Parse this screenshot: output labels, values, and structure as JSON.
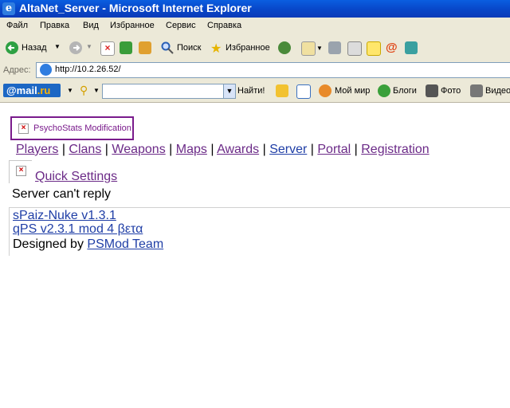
{
  "window": {
    "title": "AltaNet_Server - Microsoft Internet Explorer"
  },
  "menu": [
    "Файл",
    "Правка",
    "Вид",
    "Избранное",
    "Сервис",
    "Справка"
  ],
  "toolbar": {
    "back_label": "Назад",
    "search_label": "Поиск",
    "favorites_label": "Избранное"
  },
  "address": {
    "label": "Адрес:",
    "url": "http://10.2.26.52/"
  },
  "mailru": {
    "logo_mail": "@mail",
    "logo_ru": ".ru",
    "find_label": "Найти!",
    "items": [
      "Мой мир",
      "Блоги",
      "Фото",
      "Видео"
    ]
  },
  "page": {
    "logo_alt": "PsychoStats Modification",
    "nav": [
      "Players",
      "Clans",
      "Weapons",
      "Maps",
      "Awards",
      "Server",
      "Portal",
      "Registration"
    ],
    "quick_settings": "Quick Settings",
    "server_status": "Server can't reply",
    "credits": {
      "line1": "sPaiz-Nuke v1.3.1",
      "line2": "qPS v2.3.1 mod 4 βετα",
      "designed_by": "Designed by ",
      "team": "PSMod Team"
    }
  },
  "colors": {
    "title_blue": "#0846c8",
    "link": "#1f3ea6",
    "visited": "#6b2a87",
    "logo_border": "#7a1b8c"
  }
}
